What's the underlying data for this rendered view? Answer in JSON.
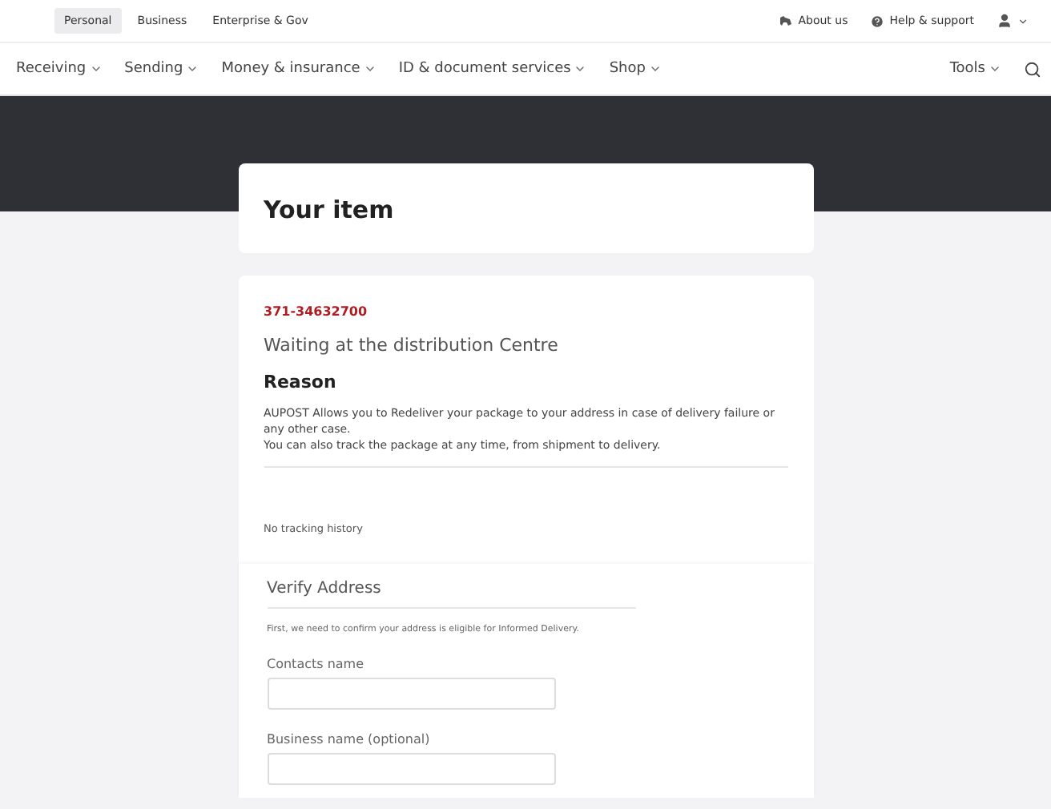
{
  "top_links": [
    {
      "label": "Personal",
      "selected": true
    },
    {
      "label": "Business",
      "selected": false
    },
    {
      "label": "Enterprise & Gov",
      "selected": false
    }
  ],
  "utility_links": [
    {
      "label": "About us",
      "kind": "about"
    },
    {
      "label": "Help & support",
      "kind": "help"
    }
  ],
  "nav": {
    "items": [
      {
        "label": "Receiving"
      },
      {
        "label": "Sending"
      },
      {
        "label": "Money & insurance"
      },
      {
        "label": "ID & document services"
      },
      {
        "label": "Shop"
      }
    ],
    "tools": "Tools"
  },
  "header_card": {
    "title": "Your item"
  },
  "tracking": {
    "number": "371-34632700",
    "status": "Waiting at the distribution Centre",
    "reason_heading": "Reason",
    "reason_lines": [
      "AUPOST Allows you to Redeliver your package to your address in case of delivery failure or any other case.",
      "You can also track the package at any time, from shipment to delivery."
    ],
    "history": "No tracking history"
  },
  "verify": {
    "title": "Verify Address",
    "intro": "First, we need to confirm your address is eligible for Informed Delivery.",
    "fields": [
      {
        "label": "Contacts name"
      },
      {
        "label": "Business name (optional)"
      }
    ]
  }
}
